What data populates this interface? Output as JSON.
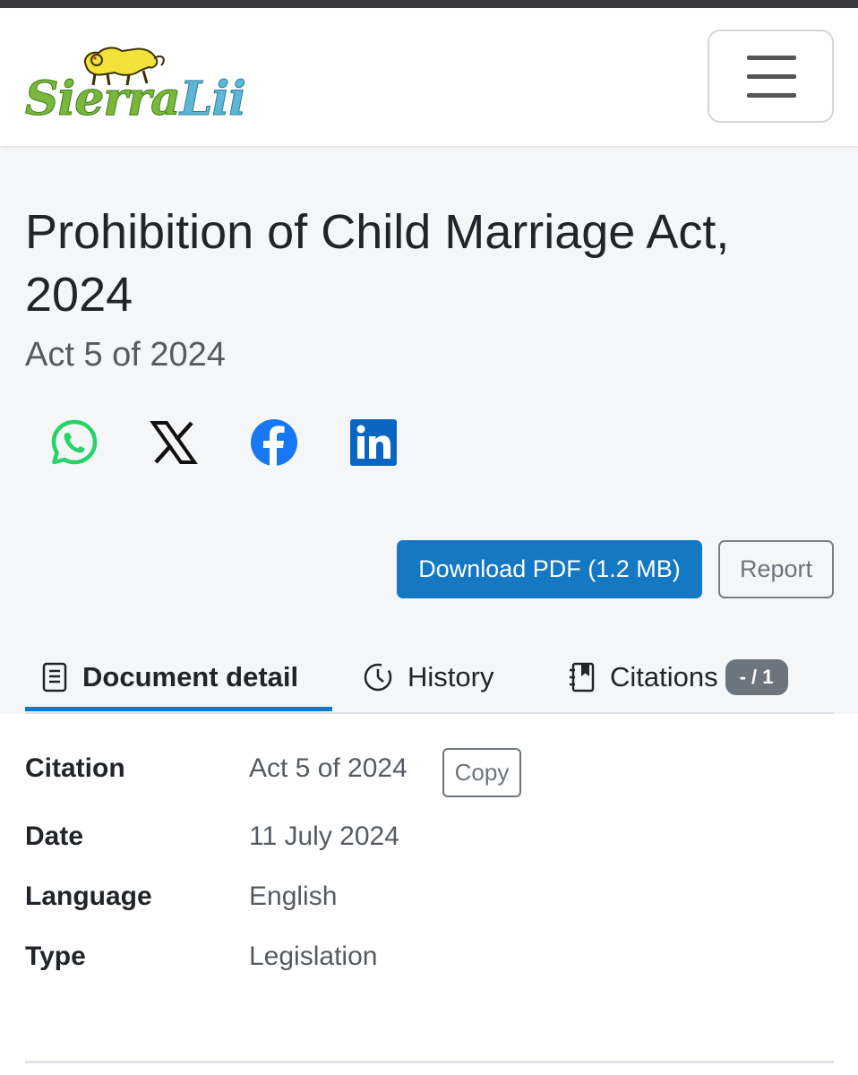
{
  "brand": {
    "logo_text_1": "Sierra",
    "logo_text_2": "Lii"
  },
  "nav": {
    "menu_icon": "hamburger-menu-icon"
  },
  "document": {
    "title": "Prohibition of Child Marriage Act, 2024",
    "subtitle": "Act 5 of 2024"
  },
  "share": [
    {
      "name": "whatsapp",
      "icon": "whatsapp-icon",
      "color": "#25d366"
    },
    {
      "name": "x",
      "icon": "x-logo-icon",
      "color": "#000000"
    },
    {
      "name": "facebook",
      "icon": "facebook-icon",
      "color": "#1877f2"
    },
    {
      "name": "linkedin",
      "icon": "linkedin-icon",
      "color": "#0a66c2"
    }
  ],
  "actions": {
    "download_label": "Download PDF (1.2 MB)",
    "report_label": "Report"
  },
  "tabs": [
    {
      "label": "Document detail",
      "icon": "document-icon",
      "active": true
    },
    {
      "label": "History",
      "icon": "clock-icon",
      "active": false
    },
    {
      "label": "Citations",
      "icon": "bookmark-notebook-icon",
      "active": false,
      "badge": "- / 1"
    }
  ],
  "details": {
    "citation_label": "Citation",
    "citation_value": "Act 5 of 2024",
    "copy_label": "Copy",
    "date_label": "Date",
    "date_value": "11 July 2024",
    "language_label": "Language",
    "language_value": "English",
    "type_label": "Type",
    "type_value": "Legislation"
  },
  "colors": {
    "primary": "#1478c2",
    "header_bg": "#f5f6f8",
    "muted_text": "#555b61"
  }
}
